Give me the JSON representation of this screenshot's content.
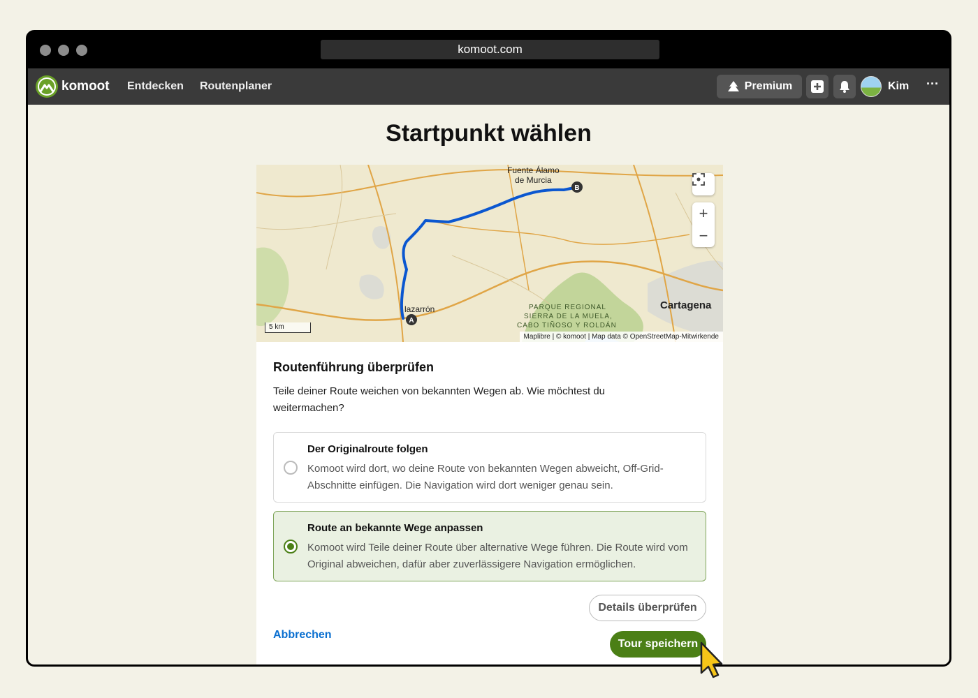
{
  "browser": {
    "url": "komoot.com",
    "traffic_lights": [
      "close",
      "minimize",
      "maximize"
    ]
  },
  "nav": {
    "logo_text": "komoot",
    "links": [
      "Entdecken",
      "Routenplaner"
    ],
    "premium_label": "Premium",
    "user_name": "Kim",
    "more_label": "···"
  },
  "page": {
    "title": "Startpunkt wählen"
  },
  "map": {
    "labels": {
      "fuente": "Fuente Álamo",
      "fuente2": "de Murcia",
      "mazarron": "lazarrón",
      "cartagena": "Cartagena",
      "park1": "PARQUE REGIONAL",
      "park2": "SIERRA DE LA MUELA,",
      "park3": "CABO TIÑOSO Y ROLDÁN"
    },
    "marker_a": "A",
    "marker_b": "B",
    "scale": "5 km",
    "attribution": "Maplibre | © komoot | Map data © OpenStreetMap-Mitwirkende",
    "zoom_in": "+",
    "zoom_out": "−",
    "colors": {
      "route": "#0b57d0",
      "road": "#e0a546",
      "park": "#b6cf8c"
    }
  },
  "review": {
    "title": "Routenführung überprüfen",
    "description": "Teile deiner Route weichen von bekannten Wegen ab. Wie möchtest du weitermachen?",
    "options": [
      {
        "title": "Der Originalroute folgen",
        "description": "Komoot wird dort, wo deine Route von bekannten Wegen abweicht, Off-Grid-Abschnitte einfügen. Die Navigation wird dort weniger genau sein.",
        "selected": false
      },
      {
        "title": "Route an bekannte Wege anpassen",
        "description": "Komoot wird Teile deiner Route über alternative Wege führen. Die Route wird vom Original abweichen, dafür aber zuverlässigere Navigation ermöglichen.",
        "selected": true
      }
    ],
    "cancel_label": "Abbrechen",
    "details_label": "Details überprüfen",
    "save_label": "Tour speichern"
  },
  "colors": {
    "accent": "#4b7f16",
    "link": "#0a6fd0",
    "background": "#f3f2e7"
  }
}
